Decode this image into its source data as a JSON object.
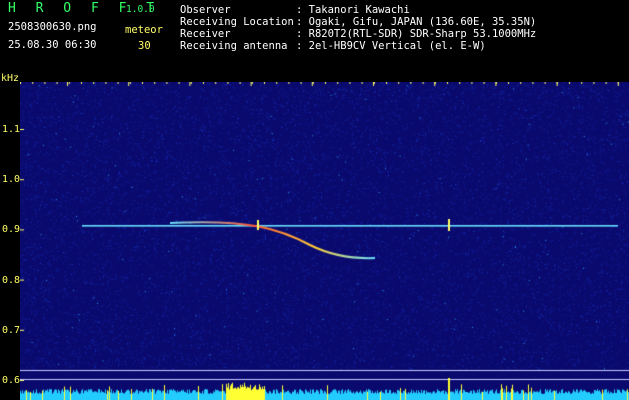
{
  "app": {
    "name": "H R O F F T",
    "version": "1.0.0"
  },
  "file": {
    "filename": "2508300630.png",
    "datetime": "25.08.30 06:30"
  },
  "counter": {
    "label": "meteor",
    "value": "30"
  },
  "info": [
    {
      "label": "Observer",
      "value": ": Takanori Kawachi"
    },
    {
      "label": "Receiving Location",
      "value": ": Ogaki, Gifu, JAPAN (136.60E, 35.35N)"
    },
    {
      "label": "Receiver",
      "value": ": R820T2(RTL-SDR) SDR-Sharp 53.1000MHz"
    },
    {
      "label": "Receiving antenna",
      "value": ": 2el-HB9CV Vertical (el. E-W)"
    }
  ],
  "axis": {
    "unit": "kHz",
    "time_ticks": [
      "0631",
      "0632",
      "0633",
      "0634",
      "0635",
      "0636",
      "0637",
      "0638",
      "0639",
      "0640"
    ],
    "freq_ticks": [
      "1.1",
      "1.0",
      "0.9",
      "0.8",
      "0.7",
      "0.6"
    ]
  },
  "colors": {
    "background": "#000000",
    "spectrum_bg": "#0a0a6e",
    "carrier": "#66e0ff",
    "meteor_trail": "#ff5533",
    "lower_bar": "#22ccff",
    "lower_bar_peak": "#ffff33",
    "text": "#ffffff",
    "label": "#ffff66",
    "title": "#33ff66"
  }
}
